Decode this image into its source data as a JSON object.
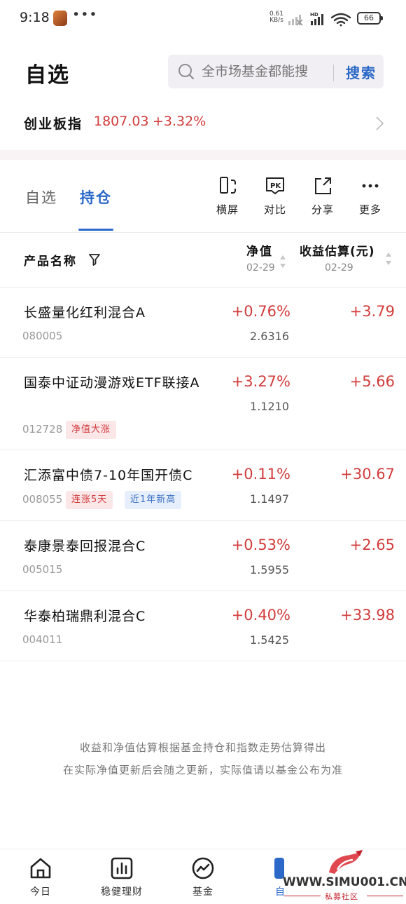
{
  "status": {
    "time": "9:18",
    "dots": "•••",
    "speed_top": "0.61",
    "speed_bottom": "KB/s",
    "battery": "66"
  },
  "header": {
    "title": "自选",
    "search_placeholder": "全市场基金都能搜",
    "search_button": "搜索"
  },
  "index": {
    "name": "创业板指",
    "value": "1807.03",
    "change": "+3.32%"
  },
  "tabs": [
    {
      "label": "自选"
    },
    {
      "label": "持仓"
    }
  ],
  "toolbar": [
    {
      "label": "横屏",
      "icon": "landscape-icon"
    },
    {
      "label": "对比",
      "icon": "pk-icon"
    },
    {
      "label": "分享",
      "icon": "share-icon"
    },
    {
      "label": "更多",
      "icon": "more-icon"
    }
  ],
  "columns": {
    "name": "产品名称",
    "nav": "净值",
    "nav_date": "02-29",
    "estimate": "收益估算(元)",
    "estimate_date": "02-29"
  },
  "funds": [
    {
      "name": "长盛量化红利混合A",
      "code": "080005",
      "pct": "+0.76%",
      "nav": "2.6316",
      "est": "+3.79",
      "tags": []
    },
    {
      "name": "国泰中证动漫游戏ETF联接A",
      "code": "012728",
      "pct": "+3.27%",
      "nav": "1.1210",
      "est": "+5.66",
      "tags": [
        {
          "label": "净值大涨",
          "style": "red"
        }
      ]
    },
    {
      "name": "汇添富中债7-10年国开债C",
      "code": "008055",
      "pct": "+0.11%",
      "nav": "1.1497",
      "est": "+30.67",
      "tags": [
        {
          "label": "连涨5天",
          "style": "red"
        },
        {
          "label": "近1年新高",
          "style": "blue"
        }
      ]
    },
    {
      "name": "泰康景泰回报混合C",
      "code": "005015",
      "pct": "+0.53%",
      "nav": "1.5955",
      "est": "+2.65",
      "tags": []
    },
    {
      "name": "华泰柏瑞鼎利混合C",
      "code": "004011",
      "pct": "+0.40%",
      "nav": "1.5425",
      "est": "+33.98",
      "tags": []
    }
  ],
  "disclaimer": {
    "line1": "收益和净值估算根据基金持仓和指数走势估算得出",
    "line2": "在实际净值更新后会随之更新，实际值请以基金公布为准"
  },
  "bottom_nav": [
    {
      "label": "今日",
      "icon": "home-icon"
    },
    {
      "label": "稳健理财",
      "icon": "chart-bar-icon"
    },
    {
      "label": "基金",
      "icon": "trend-icon"
    },
    {
      "label": "自",
      "icon": "favorites-icon"
    }
  ],
  "watermark": {
    "url": "WWW.SIMU001.CN",
    "sub": "私募社区"
  },
  "colors": {
    "accent_blue": "#2b68c8",
    "rise_red": "#d23c3c"
  }
}
